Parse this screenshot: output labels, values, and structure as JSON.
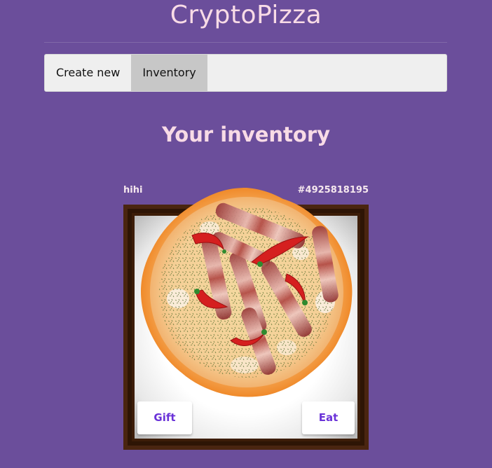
{
  "app": {
    "title": "CryptoPizza"
  },
  "nav": {
    "items": [
      {
        "label": "Create new",
        "active": false
      },
      {
        "label": "Inventory",
        "active": true
      }
    ]
  },
  "main": {
    "section_title": "Your inventory",
    "pizza_card": {
      "name": "hihi",
      "id": "#4925818195",
      "gift_label": "Gift",
      "eat_label": "Eat"
    }
  },
  "colors": {
    "background": "#6b4e9b",
    "title_text": "#f8dbe6",
    "button_text": "#6a32d8",
    "frame_wood": "#3c1d08"
  }
}
